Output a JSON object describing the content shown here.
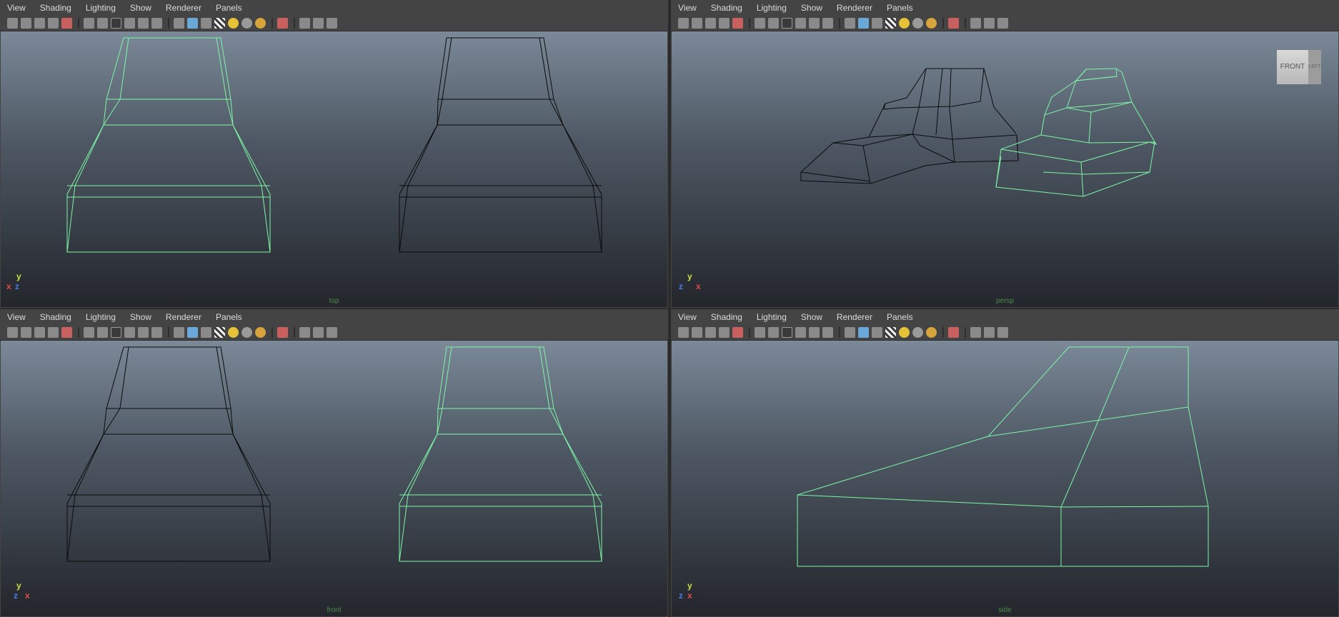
{
  "menu": [
    "View",
    "Shading",
    "Lighting",
    "Show",
    "Renderer",
    "Panels"
  ],
  "colors": {
    "wire_selected": "#7ef5a6",
    "wire_unselected": "#0b0b0b",
    "axis_x": "#e04b4b",
    "axis_y": "#c6e04b",
    "axis_z": "#4b7de0"
  },
  "toolbar_icons": [
    "camera-icon",
    "camera-attr-icon",
    "bookmark-icon",
    "image-plane-icon",
    "2d-pan-icon",
    "grid-icon",
    "film-gate-icon",
    "resolution-gate-icon",
    "gate-mask-icon",
    "field-chart-icon",
    "safe-title-icon",
    "wireframe-icon",
    "smooth-shade-icon",
    "wireframe-on-shaded-icon",
    "textured-icon",
    "default-light-icon",
    "shadows-icon",
    "ambient-occlusion-icon",
    "isolate-select-icon",
    "xray-icon",
    "xray-joints-icon",
    "share-icon"
  ],
  "viewports": [
    {
      "id": "top",
      "label": "top",
      "axes": [
        "x",
        "y",
        "z"
      ]
    },
    {
      "id": "persp",
      "label": "persp",
      "axes": [
        "z",
        "y",
        "x"
      ],
      "viewcube": {
        "front": "FRONT",
        "side": "LEFT"
      }
    },
    {
      "id": "front",
      "label": "front",
      "axes": [
        "z",
        "y",
        "x"
      ]
    },
    {
      "id": "side",
      "label": "side",
      "axes": [
        "z",
        "y",
        "x"
      ]
    }
  ]
}
